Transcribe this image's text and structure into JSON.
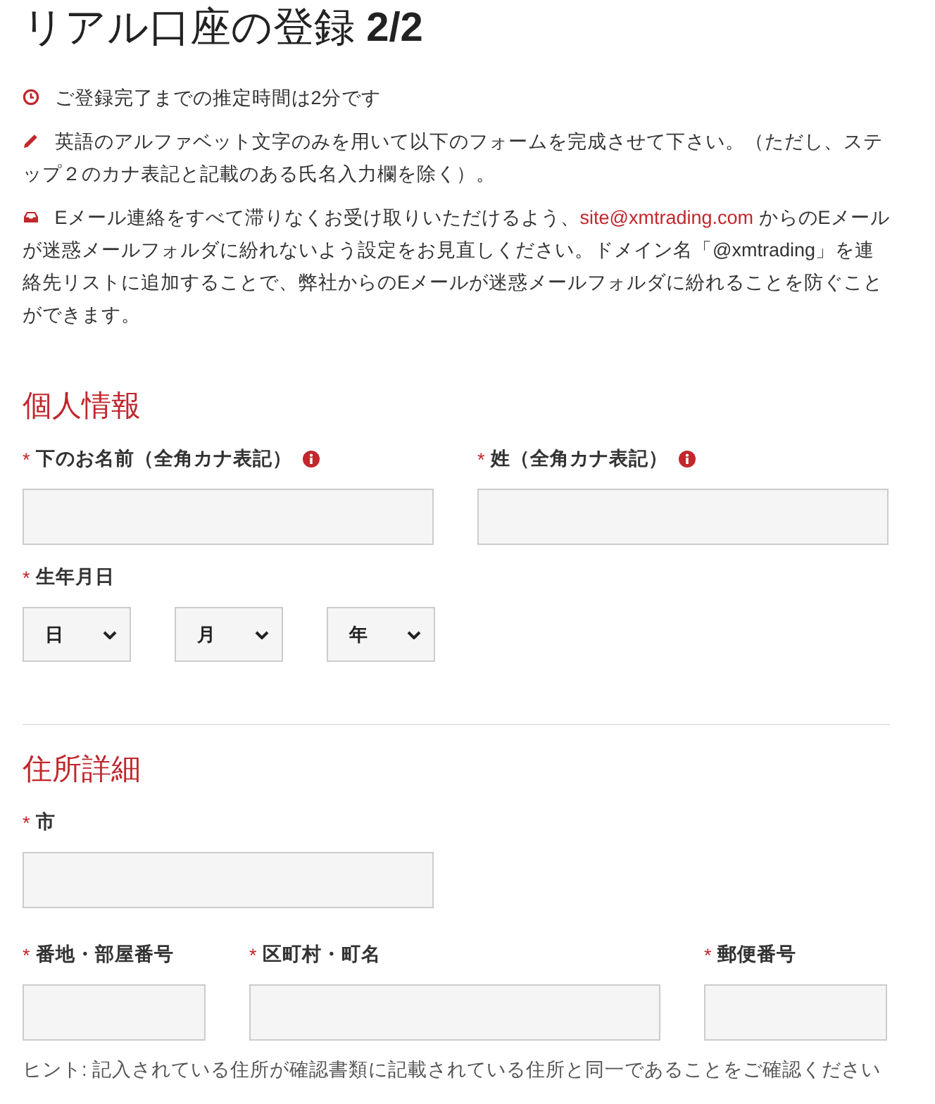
{
  "title": "リアル口座の登録 **2/2**",
  "notices": [
    {
      "kind": "clock",
      "text": "ご登録完了までの推定時間は2分です"
    },
    {
      "kind": "pencil",
      "text": "英語のアルファベット文字のみを用いて以下のフォームを完成させて下さい。（ただし、ステップ２のカナ表記と記載のある氏名入力欄を除く）。"
    },
    {
      "kind": "inbox",
      "text": "Eメール連絡をすべて滞りなくお受け取りいただけるよう、",
      "link": "site@xmtrading.com",
      "text_after": " からのEメールが迷惑メールフォルダに紛れないよう設定をお見直しください。ドメイン名「@xmtrading」を連絡先リストに追加することで、弊社からのEメールが迷惑メールフォルダに紛れることを防ぐことができます。"
    }
  ],
  "personal": {
    "title": "個人情報",
    "name_fields": [
      {
        "required_mark": "*",
        "label": "下のお名前（全角カナ表記）",
        "info": true
      },
      {
        "required_mark": "*",
        "label": "姓（全角カナ表記）",
        "info": true
      }
    ],
    "birthdate": {
      "required_mark": "*",
      "label": "生年月日",
      "selects": [
        {
          "value": "日"
        },
        {
          "value": "月"
        },
        {
          "value": "年"
        }
      ]
    }
  },
  "address": {
    "title": "住所詳細",
    "city": {
      "required_mark": "*",
      "label": "市"
    },
    "fields": [
      {
        "required_mark": "*",
        "label": "番地・部屋番号"
      },
      {
        "required_mark": "*",
        "label": "区町村・町名"
      },
      {
        "required_mark": "*",
        "label": "郵便番号"
      }
    ],
    "hint": "ヒント: 記入されている住所が確認書類に記載されている住所と同一であることをご確認ください"
  }
}
